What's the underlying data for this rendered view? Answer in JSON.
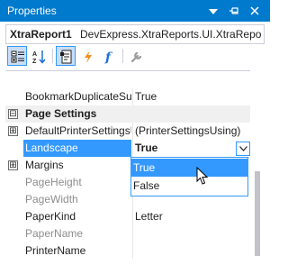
{
  "panel": {
    "title": "Properties"
  },
  "icons": {
    "dropdown": "chevron-down-icon",
    "pin": "pin-icon",
    "close": "close-icon",
    "categorized": "categorized-icon",
    "alphabetical": "sort-alphabetical-icon",
    "properties": "properties-icon",
    "events": "lightning-icon",
    "scripts": "script-icon",
    "settings": "wrench-icon"
  },
  "object_selector": {
    "name": "XtraReport1",
    "type": "DevExpress.XtraReports.UI.XtraRepo"
  },
  "rows": [
    {
      "name": "BookmarkDuplicateSu",
      "value": "True"
    },
    {
      "name": "Page Settings",
      "category": true,
      "expander": "⊟"
    },
    {
      "name": "DefaultPrinterSettingsU",
      "value": "(PrinterSettingsUsing)",
      "expander": "⊞"
    },
    {
      "name": "Landscape",
      "value": "True",
      "selected": true
    },
    {
      "name": "Margins",
      "value": "",
      "expander": "⊞"
    },
    {
      "name": "PageHeight",
      "value": "",
      "disabled": true
    },
    {
      "name": "PageWidth",
      "value": "",
      "disabled": true
    },
    {
      "name": "PaperKind",
      "value": "Letter"
    },
    {
      "name": "PaperName",
      "value": "",
      "disabled": true
    },
    {
      "name": "PrinterName",
      "value": ""
    }
  ],
  "dropdown": {
    "options": [
      "True",
      "False"
    ],
    "highlighted": "True"
  },
  "colors": {
    "accent": "#007acc",
    "selection": "#3399ff",
    "category_bg": "#f0f0f0"
  }
}
